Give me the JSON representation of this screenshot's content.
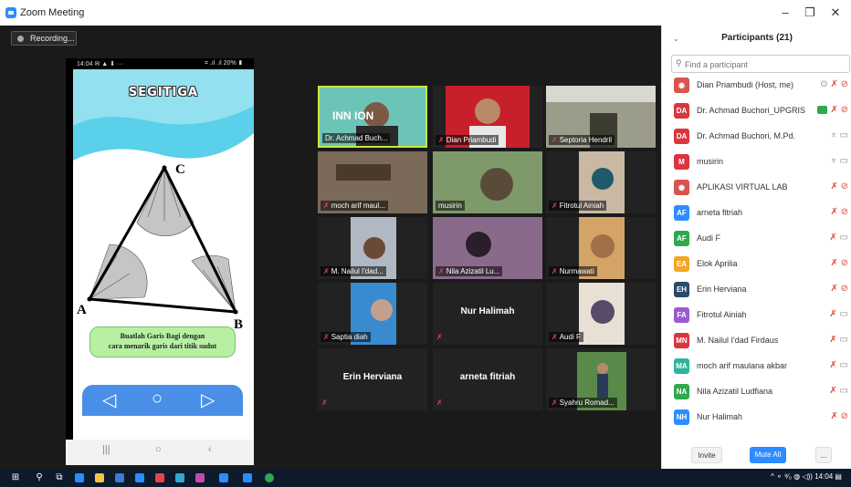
{
  "window": {
    "title": "Zoom Meeting",
    "minimize": "–",
    "restore": "❐",
    "close": "✕"
  },
  "recording": {
    "label": "Recording..."
  },
  "phone": {
    "status_left": "14:04 ✉ ▲ ⬇ ···",
    "status_right": "⌗ .ıl .ıl 20% ▮",
    "title": "SEGITIGA",
    "vertex_a": "A",
    "vertex_b": "B",
    "vertex_c": "C",
    "instruction_line1": "Buatlah Garis Bagi  dengan",
    "instruction_line2": "cara menarik garis dari titik sudut",
    "nav_back": "◁",
    "nav_home": "○",
    "nav_next": "▷",
    "sys_recent": "|||",
    "sys_home": "○",
    "sys_back": "‹"
  },
  "tiles": [
    {
      "name": "Dr. Achmad Buch...",
      "active": true,
      "muted": false,
      "banner": "INN      ION"
    },
    {
      "name": "Dian Priambudi",
      "muted": true
    },
    {
      "name": "Septoria Hendril",
      "muted": true
    },
    {
      "name": "moch arif maul...",
      "muted": true
    },
    {
      "name": "musirin",
      "muted": false
    },
    {
      "name": "Fitrotul Ainiah",
      "muted": true
    },
    {
      "name": "M. Nailul I'dad...",
      "muted": true
    },
    {
      "name": "Nila Azizatil Lu...",
      "muted": true
    },
    {
      "name": "Nurmawati",
      "muted": true
    },
    {
      "name": "Saptia diah",
      "muted": true
    },
    {
      "big": "Nur Halimah",
      "muted": true
    },
    {
      "name": "Audi F",
      "muted": true
    },
    {
      "big": "Erin Herviana",
      "muted": true
    },
    {
      "big": "arneta fitriah",
      "muted": true
    },
    {
      "name": "Syahru Romad...",
      "muted": true
    }
  ],
  "panel": {
    "title": "Participants (21)",
    "search_placeholder": "Find a participant",
    "participants": [
      {
        "initials": "",
        "color": "#d9534f",
        "photo": true,
        "name": "Dian Priambudi (Host, me)",
        "icons": "share-mic-off-video-off"
      },
      {
        "initials": "DA",
        "color": "#d9363e",
        "name": "Dr. Achmad Buchori_UPGRIS",
        "icons": "screen-mic-off-video-off"
      },
      {
        "initials": "DA",
        "color": "#d9363e",
        "name": "Dr. Achmad Buchori, M.Pd.",
        "icons": "mic-video"
      },
      {
        "initials": "M",
        "color": "#d9363e",
        "name": "musirin",
        "icons": "mic-video"
      },
      {
        "initials": "",
        "color": "#d9534f",
        "photo": true,
        "name": "APLIKASI VIRTUAL LAB",
        "icons": "mic-off-video-off"
      },
      {
        "initials": "AF",
        "color": "#2d8cff",
        "name": "arneta fitriah",
        "icons": "mic-off-video-off"
      },
      {
        "initials": "AF",
        "color": "#2fa84f",
        "name": "Audi F",
        "icons": "mic-off-video"
      },
      {
        "initials": "EA",
        "color": "#f5a623",
        "name": "Elok Aprilia",
        "icons": "mic-off-video-off"
      },
      {
        "initials": "EH",
        "color": "#2a4a6b",
        "name": "Erin Herviana",
        "icons": "mic-off-video-off"
      },
      {
        "initials": "FA",
        "color": "#9b59d6",
        "name": "Fitrotul Ainiah",
        "icons": "mic-off-video"
      },
      {
        "initials": "MN",
        "color": "#d9363e",
        "name": "M. Nailul I'dad Firdaus",
        "icons": "mic-off-video"
      },
      {
        "initials": "MA",
        "color": "#2fb39c",
        "name": "moch arif maulana akbar",
        "icons": "mic-off-video"
      },
      {
        "initials": "NA",
        "color": "#2fa84f",
        "name": "Nila Azizatil Ludfiana",
        "icons": "mic-off-video"
      },
      {
        "initials": "NH",
        "color": "#2d8cff",
        "name": "Nur Halimah",
        "icons": "mic-off-video-off"
      }
    ],
    "invite_label": "Invite",
    "mute_all_label": "Mute All",
    "more_label": "..."
  },
  "taskbar": {
    "time": "14:04",
    "tray": "^ ⚬ ⁹⁄₀ ◍ ◁)) 14:04 ▤"
  },
  "colors": {
    "zoom_blue": "#2d8cff",
    "active_border": "#c8e83c",
    "muted_red": "#e0463b",
    "taskbar": "#0d1a2b"
  }
}
